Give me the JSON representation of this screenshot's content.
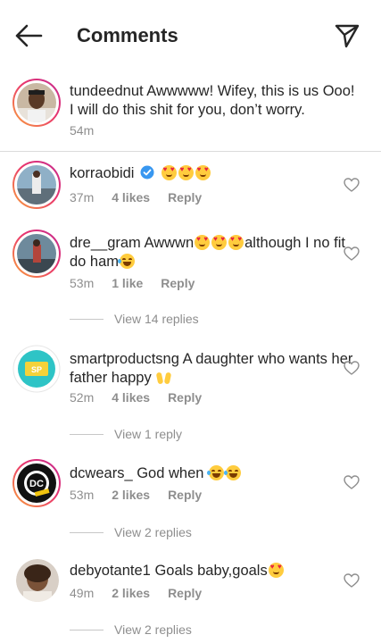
{
  "header": {
    "title": "Comments",
    "back_icon": "arrow-left-icon",
    "send_icon": "paper-plane-icon"
  },
  "caption": {
    "username": "tundeednut",
    "text": "Awwwww! Wifey, this is us Ooo! I will do this shit for you, don’t worry.",
    "time": "54m"
  },
  "comments": [
    {
      "username": "korraobidi",
      "text": "",
      "time": "37m",
      "likes": "4 likes",
      "reply": "Reply",
      "view_replies": ""
    },
    {
      "username": "dre__gram",
      "text_a": "Awwwn",
      "text_b": "although I no fit do ham",
      "time": "53m",
      "likes": "1 like",
      "reply": "Reply",
      "view_replies": "View 14 replies"
    },
    {
      "username": "smartproductsng",
      "text": "A daughter who wants her father happy",
      "time": "52m",
      "likes": "4 likes",
      "reply": "Reply",
      "view_replies": "View 1 reply",
      "avatar_text": "SP"
    },
    {
      "username": "dcwears_",
      "text": "God when",
      "time": "53m",
      "likes": "2 likes",
      "reply": "Reply",
      "view_replies": "View 2 replies",
      "avatar_text": "DC"
    },
    {
      "username": "debyotante1",
      "text": "Goals baby,goals",
      "time": "49m",
      "likes": "2 likes",
      "reply": "Reply",
      "view_replies": "View 2 replies"
    }
  ],
  "colors": {
    "verified": "#3897f0",
    "muted": "#8e8e8e",
    "text": "#262626"
  }
}
